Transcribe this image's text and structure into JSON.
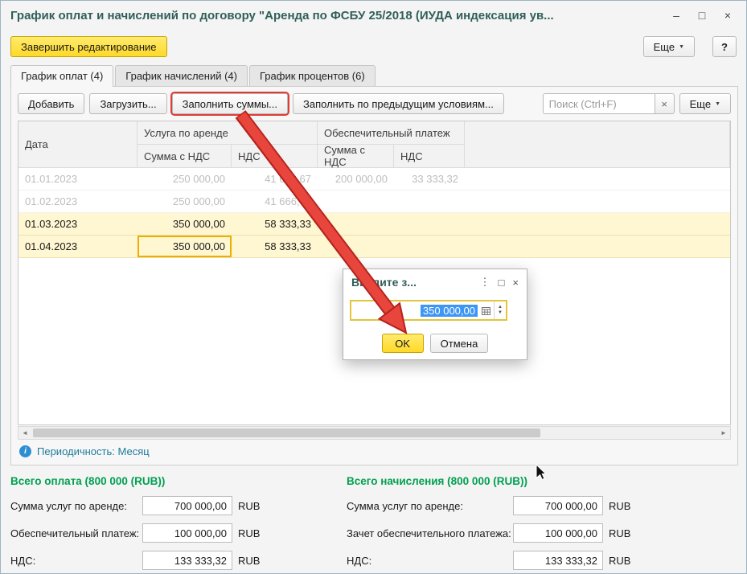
{
  "window": {
    "title": "График оплат и начислений по договору \"Аренда по ФСБУ 25/2018 (ИУДА индексация ув..."
  },
  "icons": {
    "minimize": "–",
    "maximize": "□",
    "close": "×",
    "more_arrow": "▼",
    "clear": "×",
    "menu_dots": "⋮",
    "info": "i",
    "scroll_left": "◄",
    "scroll_right": "►",
    "spin_up": "▲",
    "spin_down": "▼"
  },
  "header": {
    "finish_label": "Завершить редактирование",
    "more_label": "Еще",
    "help_label": "?"
  },
  "tabs": [
    {
      "label": "График оплат (4)",
      "active": true
    },
    {
      "label": "График начислений (4)",
      "active": false
    },
    {
      "label": "График процентов (6)",
      "active": false
    }
  ],
  "toolbar": {
    "add": "Добавить",
    "load": "Загрузить...",
    "fill_sums": "Заполнить суммы...",
    "fill_prev": "Заполнить по предыдущим условиям...",
    "search_placeholder": "Поиск (Ctrl+F)",
    "more": "Еще"
  },
  "table": {
    "header": {
      "date": "Дата",
      "service_group": "Услуга по аренде",
      "deposit_group": "Обеспечительный платеж",
      "sum_vat": "Сумма с НДС",
      "vat": "НДС"
    },
    "rows": [
      {
        "date": "01.01.2023",
        "service_sum": "250 000,00",
        "service_vat": "41 666,67",
        "deposit_sum": "200 000,00",
        "deposit_vat": "33 333,32"
      },
      {
        "date": "01.02.2023",
        "service_sum": "250 000,00",
        "service_vat": "41 666,67",
        "deposit_sum": "",
        "deposit_vat": ""
      },
      {
        "date": "01.03.2023",
        "service_sum": "350 000,00",
        "service_vat": "58 333,33",
        "deposit_sum": "",
        "deposit_vat": ""
      },
      {
        "date": "01.04.2023",
        "service_sum": "350 000,00",
        "service_vat": "58 333,33",
        "deposit_sum": "",
        "deposit_vat": ""
      }
    ]
  },
  "info": {
    "text": "Периодичность: Месяц"
  },
  "dialog": {
    "title": "Введите з...",
    "value": "350 000,00",
    "ok": "OK",
    "cancel": "Отмена"
  },
  "totals": {
    "left": {
      "title": "Всего оплата (800 000 (RUB))",
      "rows": [
        {
          "label": "Сумма услуг по аренде:",
          "value": "700 000,00",
          "currency": "RUB"
        },
        {
          "label": "Обеспечительный платеж:",
          "value": "100 000,00",
          "currency": "RUB"
        },
        {
          "label": "НДС:",
          "value": "133 333,32",
          "currency": "RUB"
        }
      ]
    },
    "right": {
      "title": "Всего начисления (800 000 (RUB))",
      "rows": [
        {
          "label": "Сумма услуг по аренде:",
          "value": "700 000,00",
          "currency": "RUB"
        },
        {
          "label": "Зачет обеспечительного платежа:",
          "value": "100 000,00",
          "currency": "RUB"
        },
        {
          "label": "НДС:",
          "value": "133 333,32",
          "currency": "RUB"
        }
      ]
    }
  },
  "colors": {
    "accent_yellow": "#ffdf3d",
    "highlight_row": "#fff6d2",
    "arrow_red": "#e8453c",
    "total_green": "#00a050",
    "link_teal": "#1e7b9c",
    "selection_blue": "#3d96f5"
  }
}
